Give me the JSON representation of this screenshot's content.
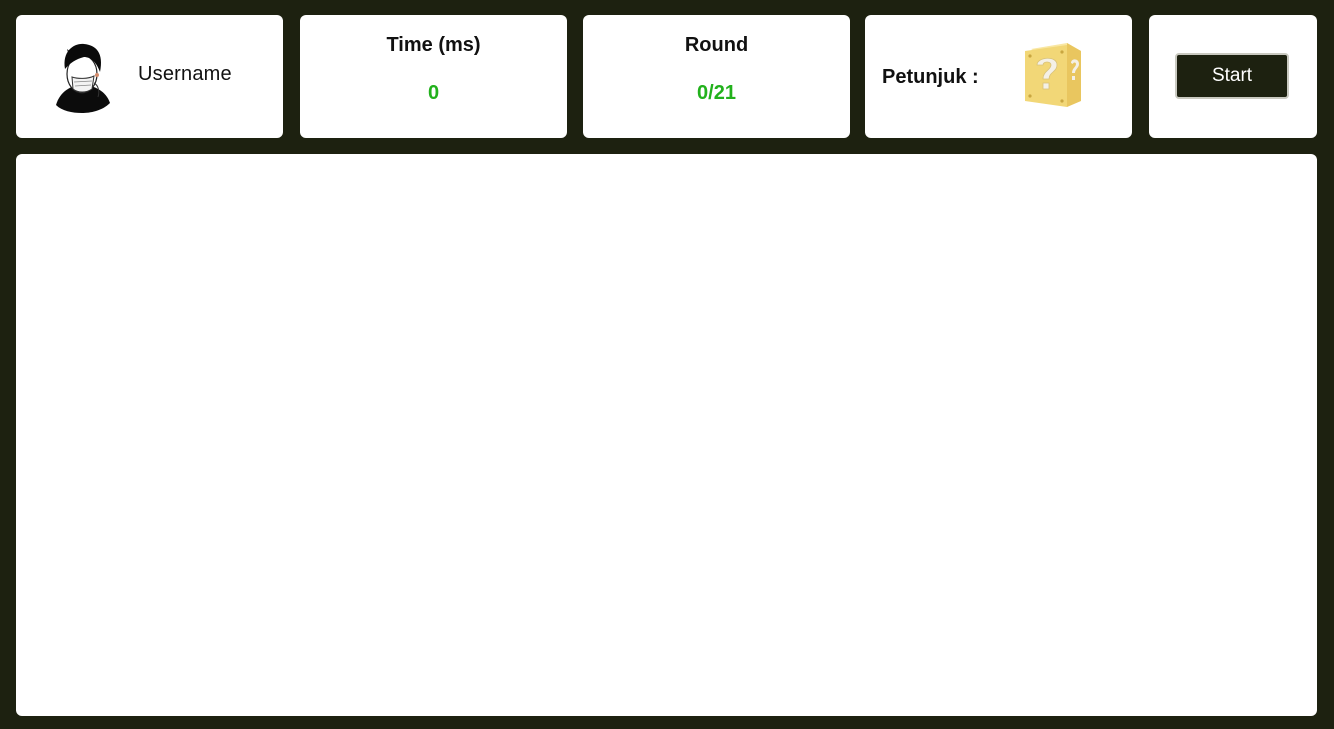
{
  "user": {
    "name": "Username",
    "avatar_icon": "avatar-icon"
  },
  "time": {
    "label": "Time (ms)",
    "value": "0"
  },
  "round": {
    "label": "Round",
    "value": "0/21"
  },
  "hint": {
    "label": "Petunjuk :",
    "icon": "question-block-icon"
  },
  "controls": {
    "start_label": "Start"
  },
  "colors": {
    "background": "#1d2110",
    "card": "#ffffff",
    "value_green": "#22b11c",
    "hint_block_yellow": "#f2d777"
  }
}
